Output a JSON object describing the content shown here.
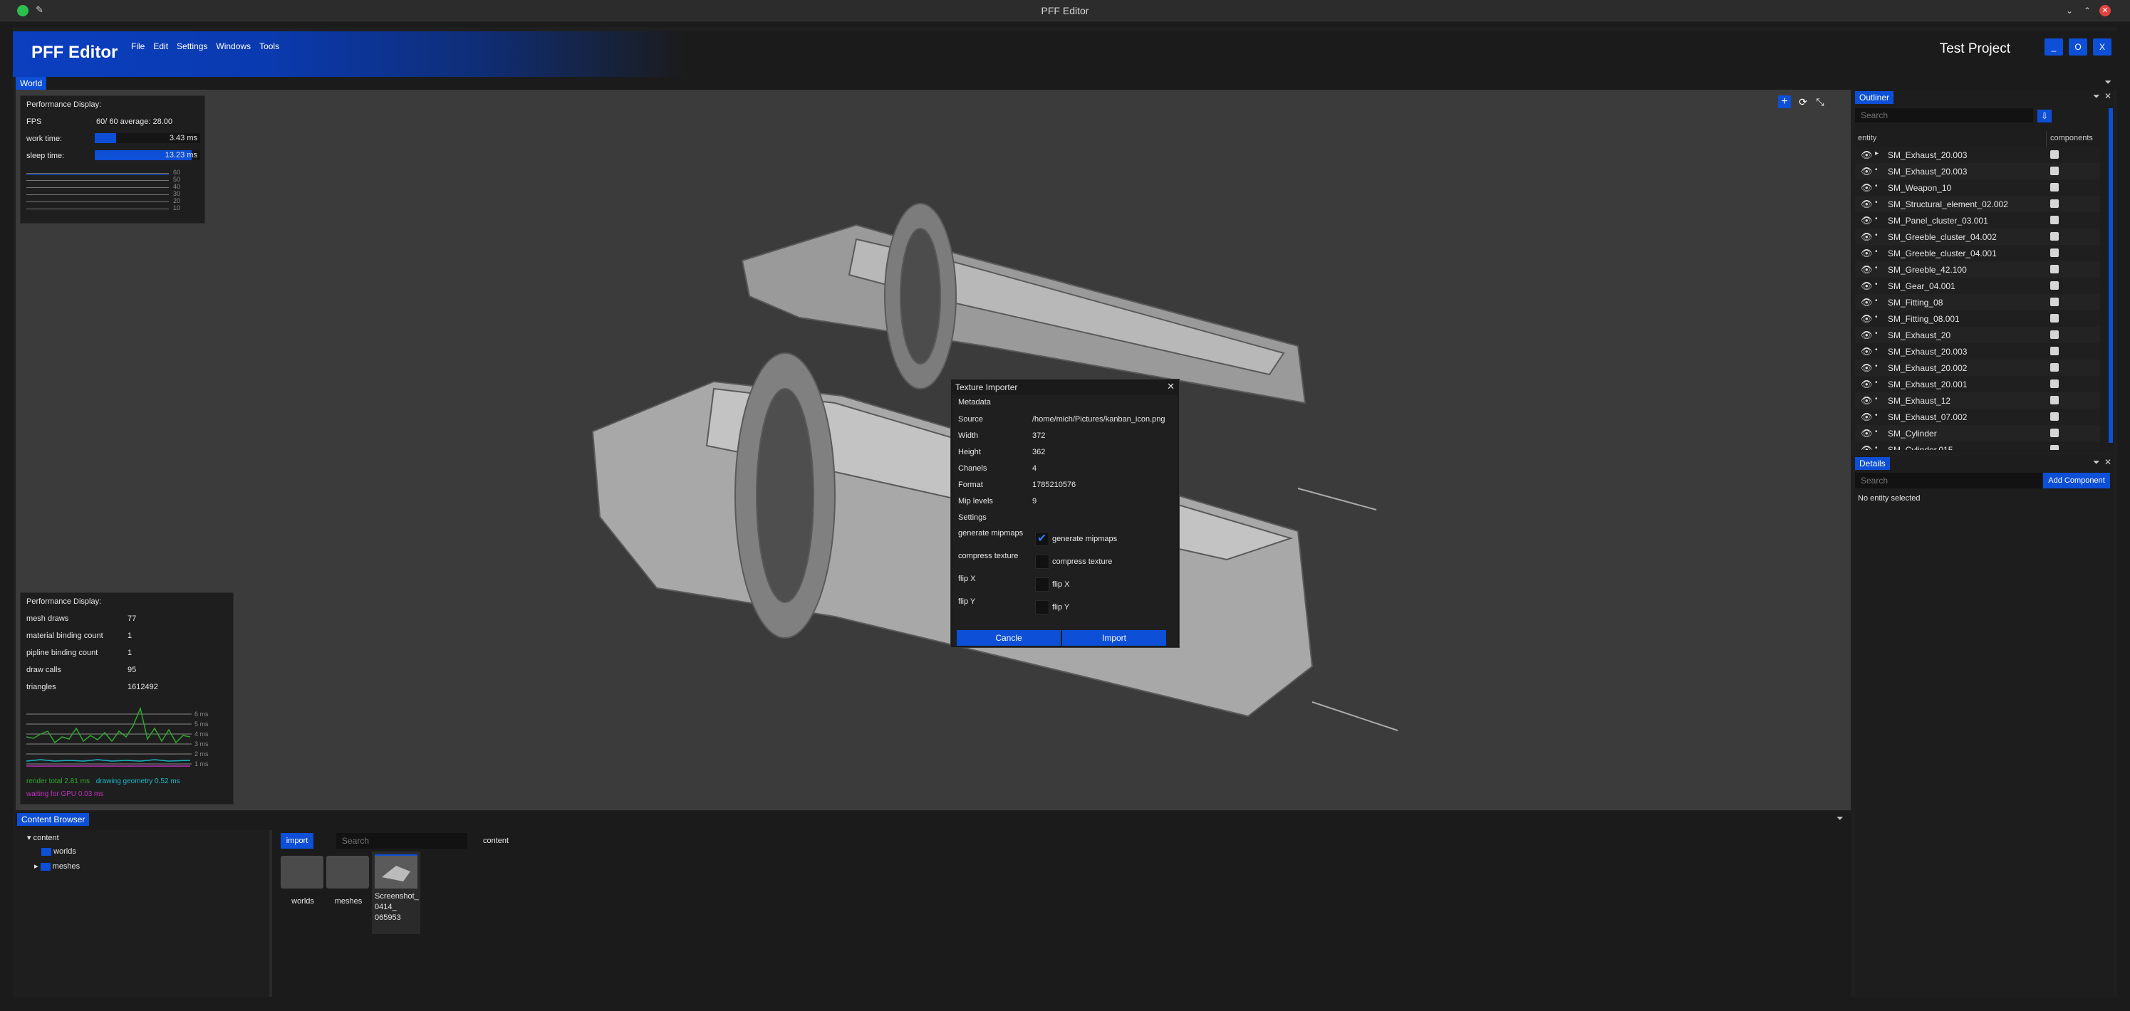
{
  "window": {
    "title": "PFF Editor"
  },
  "header": {
    "brand": "PFF Editor",
    "menu": [
      "File",
      "Edit",
      "Settings",
      "Windows",
      "Tools"
    ],
    "project": "Test Project",
    "buttons": [
      "_",
      "O",
      "X"
    ]
  },
  "viewport_tab": "World",
  "perf_top": {
    "title": "Performance Display:",
    "fps_label": "FPS",
    "fps_value": "60/  60   average: 28.00",
    "work_label": "work time:",
    "work_value": "3.43 ms",
    "work_fraction": 0.2,
    "sleep_label": "sleep time:",
    "sleep_value": "13.23 ms",
    "sleep_fraction": 0.92,
    "graph_ticks": [
      "60",
      "50",
      "40",
      "30",
      "20",
      "10"
    ]
  },
  "perf_bottom": {
    "title": "Performance Display:",
    "rows": [
      {
        "label": "mesh draws",
        "value": "77"
      },
      {
        "label": "material binding count",
        "value": "1"
      },
      {
        "label": "pipline binding count",
        "value": "1"
      },
      {
        "label": "draw calls",
        "value": "95"
      },
      {
        "label": "triangles",
        "value": "1612492"
      }
    ],
    "graph_ticks": [
      "6 ms",
      "5 ms",
      "4 ms",
      "3 ms",
      "2 ms",
      "1 ms"
    ],
    "legend": {
      "render": "render total",
      "render_value": "2.81 ms",
      "geometry": "drawing geometry",
      "geometry_value": "0.52 ms",
      "gpu": "waiting for GPU",
      "gpu_value": "0.03 ms"
    },
    "colors": {
      "render": "#2fa82f",
      "geometry": "#16b8c8",
      "gpu": "#c030c0"
    }
  },
  "dialog": {
    "title": "Texture Importer",
    "metadata_label": "Metadata",
    "rows": [
      {
        "label": "Source",
        "value": "/home/mich/Pictures/kanban_icon.png"
      },
      {
        "label": "Width",
        "value": "372"
      },
      {
        "label": "Height",
        "value": "362"
      },
      {
        "label": "Chanels",
        "value": "4"
      },
      {
        "label": "Format",
        "value": "1785210576"
      },
      {
        "label": "Mip levels",
        "value": "9"
      }
    ],
    "settings_label": "Settings",
    "settings": [
      {
        "label": "generate mipmaps",
        "checked": true
      },
      {
        "label": "compress texture",
        "checked": false
      },
      {
        "label": "flip X",
        "checked": false
      },
      {
        "label": "flip Y",
        "checked": false
      }
    ],
    "cancel": "Cancle",
    "import": "Import"
  },
  "outliner": {
    "title": "Outliner",
    "search_placeholder": "Search",
    "col_entity": "entity",
    "col_components": "components",
    "items": [
      "SM_Exhaust_20.003",
      "SM_Exhaust_20.003",
      "SM_Weapon_10",
      "SM_Structural_element_02.002",
      "SM_Panel_cluster_03.001",
      "SM_Greeble_cluster_04.002",
      "SM_Greeble_cluster_04.001",
      "SM_Greeble_42.100",
      "SM_Gear_04.001",
      "SM_Fitting_08",
      "SM_Fitting_08.001",
      "SM_Exhaust_20",
      "SM_Exhaust_20.003",
      "SM_Exhaust_20.002",
      "SM_Exhaust_20.001",
      "SM_Exhaust_12",
      "SM_Exhaust_07.002",
      "SM_Cylinder",
      "SM_Cylinder.015"
    ]
  },
  "details": {
    "title": "Details",
    "search_placeholder": "Search",
    "add_component": "Add Component",
    "empty": "No entity selected"
  },
  "content_browser": {
    "title": "Content Browser",
    "tree": {
      "root": "content",
      "children": [
        "worlds",
        "meshes"
      ]
    },
    "import": "import",
    "search_placeholder": "Search",
    "path": "content",
    "items": [
      {
        "label": "worlds"
      },
      {
        "label": "meshes"
      },
      {
        "label": "Screenshot_\n0414_\n065953"
      }
    ]
  },
  "accent": "#0d4fd6"
}
